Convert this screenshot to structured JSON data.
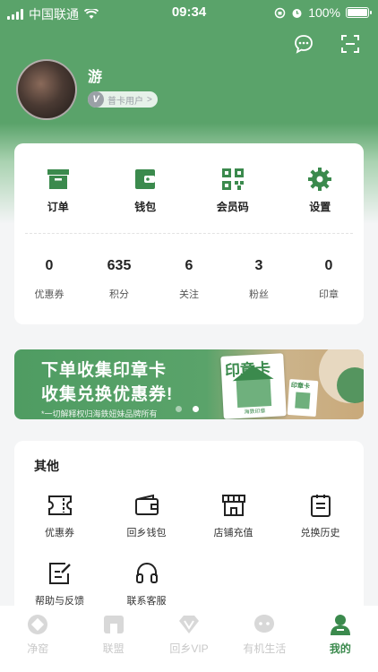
{
  "status_bar": {
    "carrier": "中国联通",
    "time": "09:34",
    "battery": "100%"
  },
  "top_icons": [
    "message-icon",
    "scan-icon"
  ],
  "profile": {
    "name": "游",
    "vip_badge_letter": "V",
    "vip_label": "普卡用户",
    "vip_arrow": ">"
  },
  "quick_actions": [
    {
      "label": "订单",
      "icon": "order-box-icon"
    },
    {
      "label": "钱包",
      "icon": "wallet-icon"
    },
    {
      "label": "会员码",
      "icon": "qr-code-icon"
    },
    {
      "label": "设置",
      "icon": "gear-icon"
    }
  ],
  "stats": [
    {
      "value": "0",
      "label": "优惠券"
    },
    {
      "value": "635",
      "label": "积分"
    },
    {
      "value": "6",
      "label": "关注"
    },
    {
      "value": "3",
      "label": "粉丝"
    },
    {
      "value": "0",
      "label": "印章"
    }
  ],
  "banner": {
    "line1": "下单收集印章卡",
    "line2": "收集兑换优惠券!",
    "note": "*一切解释权归海鉄妞妹品牌所有",
    "card_title": "印章卡",
    "card_sub": "海鉄印章",
    "mini_card_title": "印章卡"
  },
  "services": {
    "title": "其他",
    "items": [
      {
        "label": "优惠券",
        "icon": "ticket-icon"
      },
      {
        "label": "回乡钱包",
        "icon": "wallet-outline-icon"
      },
      {
        "label": "店铺充值",
        "icon": "store-icon"
      },
      {
        "label": "兑换历史",
        "icon": "clipboard-icon"
      },
      {
        "label": "帮助与反馈",
        "icon": "edit-note-icon"
      },
      {
        "label": "联系客服",
        "icon": "headset-icon"
      }
    ]
  },
  "tab_bar": [
    {
      "label": "净窑",
      "icon": "home-icon"
    },
    {
      "label": "联盟",
      "icon": "shop-icon"
    },
    {
      "label": "回乡VIP",
      "icon": "diamond-icon"
    },
    {
      "label": "有机生活",
      "icon": "chat-bubble-icon"
    },
    {
      "label": "我的",
      "icon": "user-icon",
      "active": true
    }
  ],
  "colors": {
    "brand_green": "#5aa36a",
    "icon_green": "#3b8a4d",
    "inactive": "#c8c8c8"
  }
}
